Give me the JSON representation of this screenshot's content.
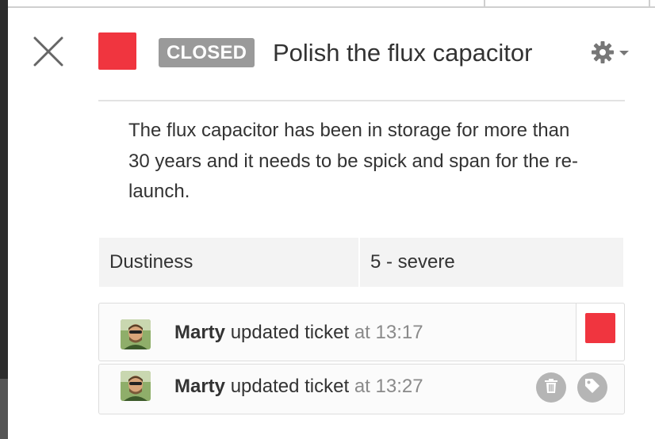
{
  "ticket": {
    "status_label": "CLOSED",
    "status_color": "#f0353f",
    "title": "Polish the flux capacitor",
    "description": "The flux capacitor has been in storage for more than 30 years and it needs to be spick and span for the re-launch."
  },
  "fields": [
    {
      "name": "Dustiness",
      "value": "5 - severe"
    }
  ],
  "activity": [
    {
      "user": "Marty",
      "action": "updated ticket",
      "time": "at 13:17",
      "has_status_swatch": true
    },
    {
      "user": "Marty",
      "action": "updated ticket",
      "time": "at 13:27",
      "actions": [
        "trash-icon",
        "tag-icon"
      ]
    }
  ],
  "icons": {
    "close": "close-icon",
    "settings": "gear-icon",
    "dropdown": "caret-down-icon"
  },
  "colors": {
    "badge_bg": "#9a9a9a",
    "accent_red": "#f0353f",
    "muted_text": "#8a8a8a"
  }
}
